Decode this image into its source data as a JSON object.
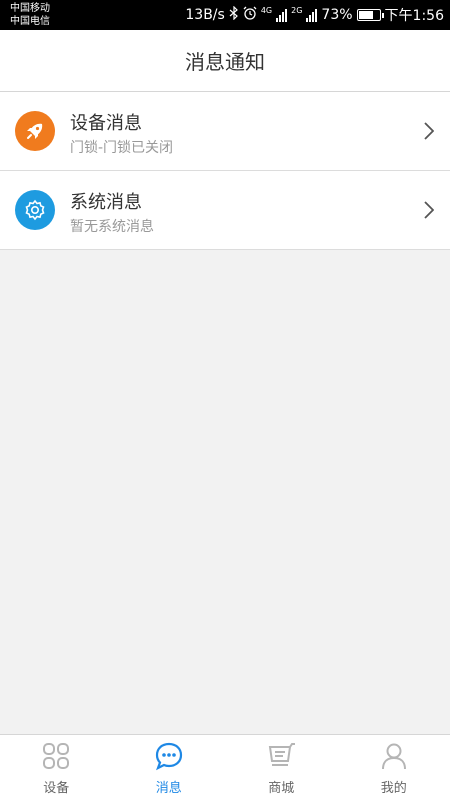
{
  "status_bar": {
    "carrier_1": "中国移动",
    "carrier_2": "中国电信",
    "net_speed": "13B/s",
    "signal_1_tag": "4G",
    "signal_2_tag": "2G",
    "battery_percent": "73%",
    "battery_level": 0.73,
    "time": "下午1:56"
  },
  "header": {
    "title": "消息通知"
  },
  "messages": [
    {
      "title": "设备消息",
      "subtitle": "门锁-门锁已关闭",
      "icon": "rocket-icon",
      "icon_color": "#f07b1e"
    },
    {
      "title": "系统消息",
      "subtitle": "暂无系统消息",
      "icon": "gear-icon",
      "icon_color": "#1e9be0"
    }
  ],
  "tabs": [
    {
      "label": "设备",
      "icon": "grid-icon",
      "active": false
    },
    {
      "label": "消息",
      "icon": "chat-icon",
      "active": true
    },
    {
      "label": "商城",
      "icon": "cart-icon",
      "active": false
    },
    {
      "label": "我的",
      "icon": "person-icon",
      "active": false
    }
  ],
  "colors": {
    "accent": "#1e88e5",
    "inactive_icon": "#b5b5b5",
    "background": "#f2f2f2"
  }
}
